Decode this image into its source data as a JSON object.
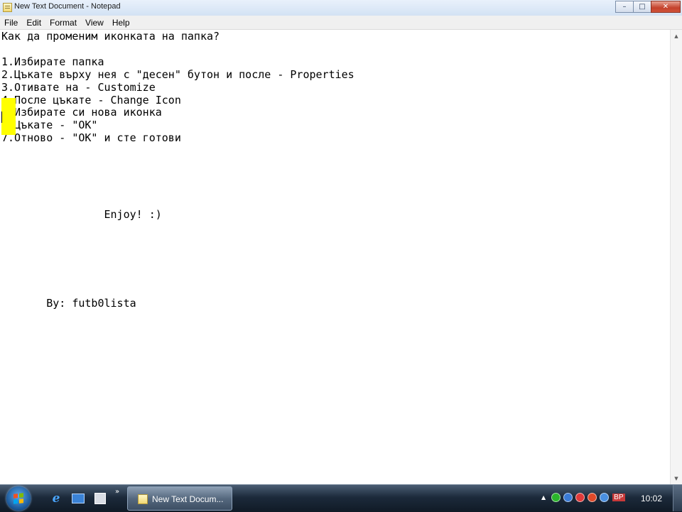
{
  "window": {
    "title": "New Text Document - Notepad",
    "controls": {
      "minimize": "–",
      "maximize": "□",
      "close": "✕"
    }
  },
  "menu": [
    "File",
    "Edit",
    "Format",
    "View",
    "Help"
  ],
  "document": {
    "lines": [
      "Как да променим иконката на папка?",
      "",
      "1.Избирате папка",
      "2.Цъкате върху нея с \"десен\" бутон и после - Properties",
      "3.Отивате на - Customize",
      "4.После цъкате - Change Icon",
      "5.Избирате си нова иконка",
      "6.Цъкате - \"OK\"",
      "7.Отново - \"OK\" и сте готови",
      "",
      "",
      "",
      "",
      "",
      "                Enjoy! :)",
      "",
      "",
      "",
      "",
      "",
      "",
      "       By: futb0lista"
    ]
  },
  "taskbar": {
    "quick_launch_more": "»",
    "task_button_label": "New Text Docum...",
    "tray_arrow": "▲",
    "language": "BP",
    "clock": "10:02",
    "tray_icon_colors": [
      "#2bb52b",
      "#3a7bd5",
      "#e03a3a",
      "#e04a2a",
      "#4a90e2"
    ]
  },
  "colors": {
    "highlight": "#ffff00"
  }
}
